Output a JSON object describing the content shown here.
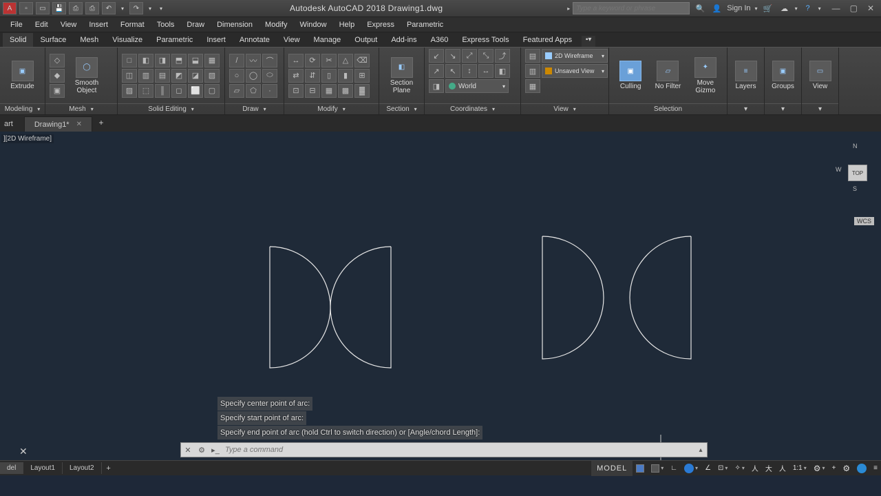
{
  "title": "Autodesk AutoCAD 2018   Drawing1.dwg",
  "qat_search_placeholder": "Type a keyword or phrase",
  "sign_in": "Sign In",
  "menu": [
    "File",
    "Edit",
    "View",
    "Insert",
    "Format",
    "Tools",
    "Draw",
    "Dimension",
    "Modify",
    "Window",
    "Help",
    "Express",
    "Parametric"
  ],
  "ribbon_tabs": [
    "Solid",
    "Surface",
    "Mesh",
    "Visualize",
    "Parametric",
    "Insert",
    "Annotate",
    "View",
    "Manage",
    "Output",
    "Add-ins",
    "A360",
    "Express Tools",
    "Featured Apps"
  ],
  "panels": {
    "modeling": {
      "label": "Modeling",
      "btn_extrude": "Extrude"
    },
    "mesh": {
      "label": "Mesh",
      "btn_smooth": "Smooth\nObject"
    },
    "solid_editing": {
      "label": "Solid Editing"
    },
    "draw": {
      "label": "Draw"
    },
    "modify": {
      "label": "Modify"
    },
    "section": {
      "label": "Section",
      "btn_section": "Section\nPlane"
    },
    "coords": {
      "label": "Coordinates",
      "world": "World"
    },
    "view": {
      "label": "View",
      "visual_style": "2D Wireframe",
      "saved_view": "Unsaved View"
    },
    "selection": {
      "label": "Selection",
      "culling": "Culling",
      "no_filter": "No Filter",
      "gizmo": "Move\nGizmo"
    },
    "layers": {
      "label": "Layers"
    },
    "groups": {
      "label": "Groups"
    },
    "view_panel": {
      "label": "View"
    }
  },
  "doc_tabs": {
    "start": "art",
    "active": "Drawing1*"
  },
  "viewport_label": "][2D Wireframe]",
  "viewcube": {
    "top": "TOP",
    "n": "N",
    "s": "S",
    "w": "W",
    "wcs": "WCS"
  },
  "cmd_history": [
    "Specify center point of arc:",
    "Specify start point of arc:",
    "Specify end point of arc (hold Ctrl to switch direction) or [Angle/chord Length]:"
  ],
  "cmd_placeholder": "Type a command",
  "layout_tabs": {
    "model": "del",
    "l1": "Layout1",
    "l2": "Layout2"
  },
  "status": {
    "model": "MODEL",
    "scale": "1:1"
  }
}
